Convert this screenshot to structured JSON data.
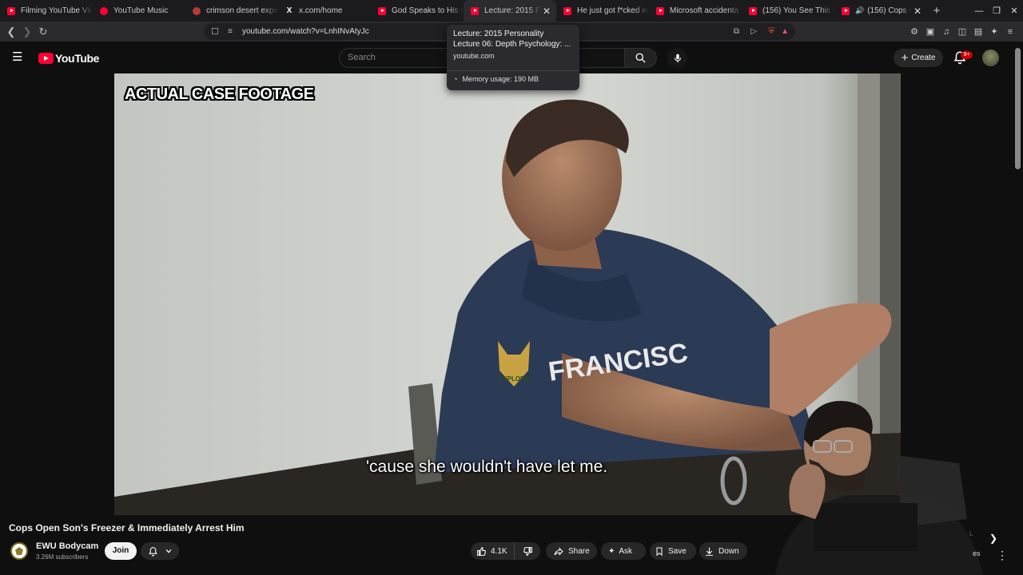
{
  "browser": {
    "tabs": [
      {
        "title": "Filming YouTube Vid",
        "icon": "youtube-icon"
      },
      {
        "title": "YouTube Music",
        "icon": "youtube-music-icon"
      },
      {
        "title": "crimson desert expa",
        "icon": "site-icon"
      },
      {
        "title": "x.com/home",
        "icon": "x-icon"
      },
      {
        "title": "God Speaks to His C",
        "icon": "youtube-icon"
      },
      {
        "title": "Lecture: 2015 Pe",
        "icon": "youtube-icon",
        "active": true
      },
      {
        "title": "He just got f*cked in",
        "icon": "youtube-icon"
      },
      {
        "title": "Microsoft accidenta",
        "icon": "youtube-icon"
      },
      {
        "title": "(156) You See This B",
        "icon": "youtube-icon"
      },
      {
        "title": "(156) Cops Op",
        "icon": "youtube-icon",
        "audio": true
      }
    ],
    "url": "youtube.com/watch?v=LnhINvAtyJc",
    "tab_preview": {
      "line1": "Lecture: 2015 Personality",
      "line2": "Lecture 06: Depth Psychology: ...",
      "domain": "youtube.com",
      "memory": "Memory usage: 190 MB"
    }
  },
  "youtube": {
    "logo_text": "YouTube",
    "search_placeholder": "Search",
    "create_label": "Create",
    "notification_count": "9+",
    "accent_color": "#ff0033"
  },
  "video": {
    "overlay_label": "ACTUAL CASE FOOTAGE",
    "caption": "'cause she wouldn't have let me.",
    "title": "Cops Open Son's Freezer & Immediately Arrest Him",
    "shirt_text": "FRANCISC",
    "watermark_text": "EXPLORE"
  },
  "channel": {
    "name": "EWU Bodycam",
    "subscribers": "3.26M subscribers",
    "join_label": "Join"
  },
  "actions": {
    "likes": "4.1K",
    "share": "Share",
    "ask": "Ask",
    "save": "Save",
    "download": "Down"
  },
  "misc": {
    "partial_label": "es"
  }
}
